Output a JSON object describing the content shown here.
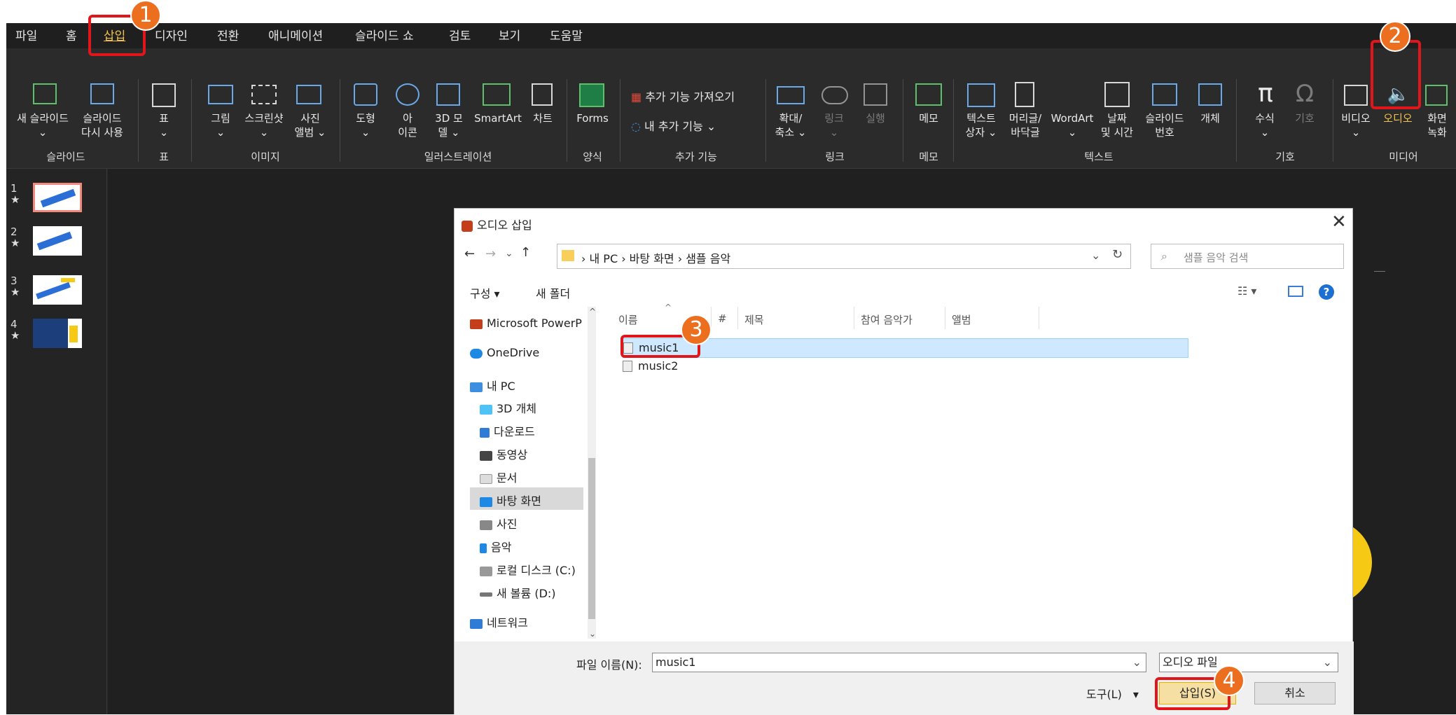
{
  "ribbon_tabs": [
    "파일",
    "홈",
    "삽입",
    "디자인",
    "전환",
    "애니메이션",
    "슬라이드 쇼",
    "검토",
    "보기",
    "도움말"
  ],
  "ribbon": {
    "new_slide": "새 슬라이드\n⌄",
    "reuse_slide": "슬라이드\n다시 사용",
    "table": "표\n⌄",
    "picture": "그림\n⌄",
    "screenshot": "스크린샷\n⌄",
    "photo_album": "사진\n앨범 ⌄",
    "shapes": "도형\n⌄",
    "icons": "아\n이콘",
    "models_3d": "3D 모\n델 ⌄",
    "smartart": "SmartArt",
    "chart": "차트",
    "forms": "Forms",
    "get_addins": "추가 기능 가져오기",
    "my_addins": "내 추가 기능  ⌄",
    "zoom": "확대/\n축소 ⌄",
    "link": "링크\n⌄",
    "action": "실행",
    "comment": "메모",
    "textbox": "텍스트\n상자 ⌄",
    "header_footer": "머리글/\n바닥글",
    "wordart": "WordArt\n⌄",
    "datetime": "날짜\n및 시간",
    "slide_number": "슬라이드\n번호",
    "object": "개체",
    "equation": "수식\n⌄",
    "symbol": "기호",
    "video": "비디오\n⌄",
    "audio": "오디오",
    "screen_recording": "화면\n녹화",
    "groups": {
      "slides": "슬라이드",
      "tables": "표",
      "images": "이미지",
      "illustrations": "일러스트레이션",
      "forms": "양식",
      "addins": "추가 기능",
      "links": "링크",
      "comments": "메모",
      "text": "텍스트",
      "symbols": "기호",
      "media": "미디어"
    }
  },
  "slides": [
    {
      "num": "1",
      "mark": "★"
    },
    {
      "num": "2",
      "mark": "★"
    },
    {
      "num": "3",
      "mark": "★"
    },
    {
      "num": "4",
      "mark": "★"
    }
  ],
  "badges": [
    "1",
    "2",
    "3",
    "4"
  ],
  "dialog": {
    "title": "오디오 삽입",
    "breadcrumb": "›  내 PC  ›  바탕 화면  ›  샘플 음악",
    "search_placeholder": "샘플 음악 검색",
    "organize": "구성 ▾",
    "new_folder": "새 폴더",
    "tree": [
      "Microsoft PowerP",
      "OneDrive",
      "내 PC",
      "3D 개체",
      "다운로드",
      "동영상",
      "문서",
      "바탕 화면",
      "사진",
      "음악",
      "로컬 디스크 (C:)",
      "새 볼륨 (D:)",
      "네트워크"
    ],
    "columns": [
      "이름",
      "#",
      "제목",
      "참여 음악가",
      "앨범"
    ],
    "files": [
      "music1",
      "music2"
    ],
    "filename_label": "파일 이름(N):",
    "filename_value": "music1",
    "filetype": "오디오 파일",
    "tools": "도구(L)",
    "insert": "삽입(S)",
    "cancel": "취소"
  },
  "colors": {
    "accent": "#f3c24a",
    "callout": "#e0161b",
    "badge": "#ec6f1f",
    "selection": "#cde8ff"
  }
}
